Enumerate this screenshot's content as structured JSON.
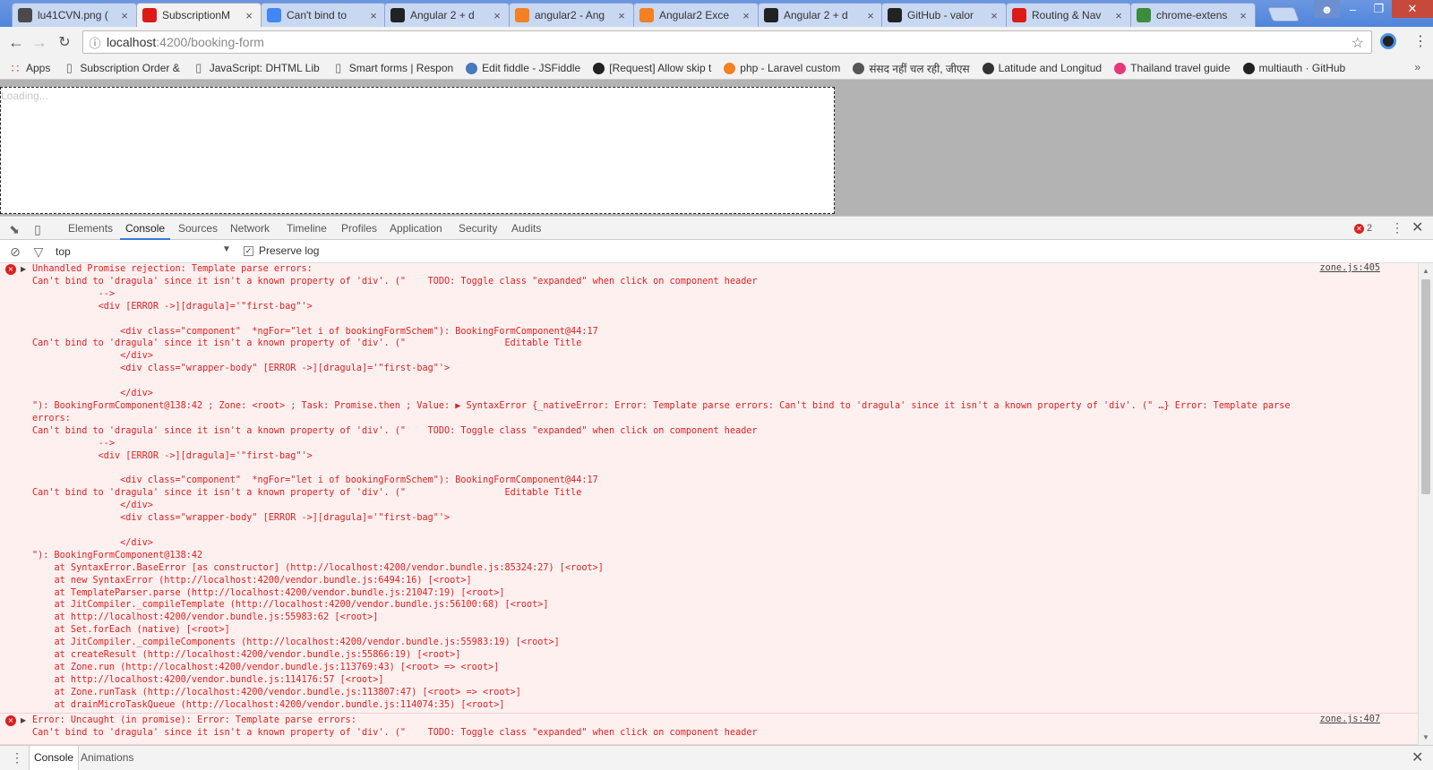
{
  "browser": {
    "tabs": [
      {
        "label": "lu41CVN.png (",
        "fav": "image-icon",
        "color": "#4a4a4a"
      },
      {
        "label": "SubscriptionM",
        "fav": "angular-icon",
        "color": "#dd1b16",
        "active": true
      },
      {
        "label": "Can't bind to",
        "fav": "google-icon",
        "color": "#4285f4"
      },
      {
        "label": "Angular 2 + d",
        "fav": "github-icon",
        "color": "#222"
      },
      {
        "label": "angular2 - Ang",
        "fav": "stackoverflow-icon",
        "color": "#f48024"
      },
      {
        "label": "Angular2 Exce",
        "fav": "stackoverflow-icon",
        "color": "#f48024"
      },
      {
        "label": "Angular 2 + d",
        "fav": "github-icon",
        "color": "#222"
      },
      {
        "label": "GitHub - valor",
        "fav": "github-icon",
        "color": "#222"
      },
      {
        "label": "Routing & Nav",
        "fav": "angular-icon",
        "color": "#dd1b16"
      },
      {
        "label": "chrome-extens",
        "fav": "chrome-icon",
        "color": "#3b8c3b"
      }
    ],
    "url_host": "localhost",
    "url_path": ":4200/booking-form"
  },
  "bookmarks": [
    {
      "label": "Apps",
      "icon": "apps-grid-icon",
      "color": "#e34a3a"
    },
    {
      "label": "Subscription Order &",
      "icon": "document-icon",
      "color": "#666"
    },
    {
      "label": "JavaScript: DHTML Lib",
      "icon": "document-icon",
      "color": "#666"
    },
    {
      "label": "Smart forms | Respon",
      "icon": "document-icon",
      "color": "#666"
    },
    {
      "label": "Edit fiddle - JSFiddle",
      "icon": "jsfiddle-icon",
      "color": "#4679bd"
    },
    {
      "label": "[Request] Allow skip t",
      "icon": "github-icon",
      "color": "#222"
    },
    {
      "label": "php - Laravel custom",
      "icon": "stackoverflow-icon",
      "color": "#f48024"
    },
    {
      "label": "संसद नहीं चल रही, जीएस",
      "icon": "news-icon",
      "color": "#555"
    },
    {
      "label": "Latitude and Longitud",
      "icon": "compass-icon",
      "color": "#333"
    },
    {
      "label": "Thailand travel guide",
      "icon": "travel-icon",
      "color": "#e5397a"
    },
    {
      "label": "multiauth · GitHub",
      "icon": "github-icon",
      "color": "#222"
    }
  ],
  "page": {
    "loading_text": "Loading..."
  },
  "devtools": {
    "tabs": [
      "Elements",
      "Console",
      "Sources",
      "Network",
      "Timeline",
      "Profiles",
      "Application",
      "Security",
      "Audits"
    ],
    "active_tab": "Console",
    "error_count": "2",
    "context": "top",
    "preserve_log_label": "Preserve log",
    "drawer_tabs": [
      "Console",
      "Animations"
    ],
    "messages": [
      {
        "source": "zone.js:405",
        "lines": [
          "Unhandled Promise rejection: Template parse errors:",
          "Can't bind to 'dragula' since it isn't a known property of 'div'. (\"    TODO: Toggle class \"expanded\" when click on component header",
          "            -->",
          "            <div [ERROR ->][dragula]='\"first-bag\"'>",
          "",
          "                <div class=\"component\"  *ngFor=\"let i of bookingFormSchem\"): BookingFormComponent@44:17",
          "Can't bind to 'dragula' since it isn't a known property of 'div'. (\"                  Editable Title",
          "                </div>",
          "                <div class=\"wrapper-body\" [ERROR ->][dragula]='\"first-bag\"'>",
          "",
          "                </div>",
          "\"): BookingFormComponent@138:42 ; Zone: <root> ; Task: Promise.then ; Value: ▶ SyntaxError {_nativeError: Error: Template parse errors: Can't bind to 'dragula' since it isn't a known property of 'div'. (\" …} Error: Template parse",
          "errors:",
          "Can't bind to 'dragula' since it isn't a known property of 'div'. (\"    TODO: Toggle class \"expanded\" when click on component header",
          "            -->",
          "            <div [ERROR ->][dragula]='\"first-bag\"'>",
          "",
          "                <div class=\"component\"  *ngFor=\"let i of bookingFormSchem\"): BookingFormComponent@44:17",
          "Can't bind to 'dragula' since it isn't a known property of 'div'. (\"                  Editable Title",
          "                </div>",
          "                <div class=\"wrapper-body\" [ERROR ->][dragula]='\"first-bag\"'>",
          "",
          "                </div>",
          "\"): BookingFormComponent@138:42",
          "    at SyntaxError.BaseError [as constructor] (http://localhost:4200/vendor.bundle.js:85324:27) [<root>]",
          "    at new SyntaxError (http://localhost:4200/vendor.bundle.js:6494:16) [<root>]",
          "    at TemplateParser.parse (http://localhost:4200/vendor.bundle.js:21047:19) [<root>]",
          "    at JitCompiler._compileTemplate (http://localhost:4200/vendor.bundle.js:56100:68) [<root>]",
          "    at http://localhost:4200/vendor.bundle.js:55983:62 [<root>]",
          "    at Set.forEach (native) [<root>]",
          "    at JitCompiler._compileComponents (http://localhost:4200/vendor.bundle.js:55983:19) [<root>]",
          "    at createResult (http://localhost:4200/vendor.bundle.js:55866:19) [<root>]",
          "    at Zone.run (http://localhost:4200/vendor.bundle.js:113769:43) [<root> => <root>]",
          "    at http://localhost:4200/vendor.bundle.js:114176:57 [<root>]",
          "    at Zone.runTask (http://localhost:4200/vendor.bundle.js:113807:47) [<root> => <root>]",
          "    at drainMicroTaskQueue (http://localhost:4200/vendor.bundle.js:114074:35) [<root>]"
        ]
      },
      {
        "source": "zone.js:407",
        "lines": [
          "Error: Uncaught (in promise): Error: Template parse errors:",
          "Can't bind to 'dragula' since it isn't a known property of 'div'. (\"    TODO: Toggle class \"expanded\" when click on component header"
        ]
      }
    ]
  }
}
